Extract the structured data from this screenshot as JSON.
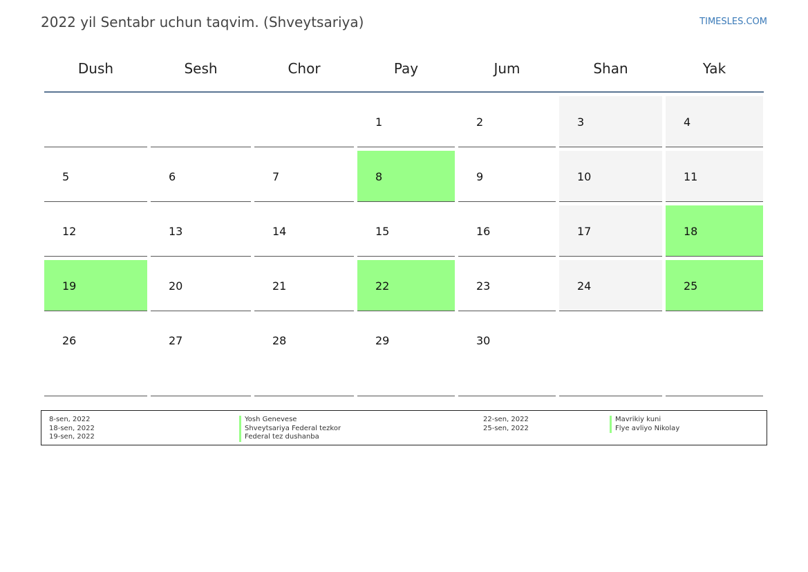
{
  "header": {
    "title": "2022 yil Sentabr uchun taqvim. (Shveytsariya)",
    "site": "TIMESLES.COM"
  },
  "calendar": {
    "weekdays": [
      "Dush",
      "Sesh",
      "Chor",
      "Pay",
      "Jum",
      "Shan",
      "Yak"
    ],
    "weeks": [
      [
        {
          "n": ""
        },
        {
          "n": ""
        },
        {
          "n": ""
        },
        {
          "n": "1"
        },
        {
          "n": "2"
        },
        {
          "n": "3",
          "t": "weekend"
        },
        {
          "n": "4",
          "t": "weekend"
        }
      ],
      [
        {
          "n": "5"
        },
        {
          "n": "6"
        },
        {
          "n": "7"
        },
        {
          "n": "8",
          "t": "holiday"
        },
        {
          "n": "9"
        },
        {
          "n": "10",
          "t": "weekend"
        },
        {
          "n": "11",
          "t": "weekend"
        }
      ],
      [
        {
          "n": "12"
        },
        {
          "n": "13"
        },
        {
          "n": "14"
        },
        {
          "n": "15"
        },
        {
          "n": "16"
        },
        {
          "n": "17",
          "t": "weekend"
        },
        {
          "n": "18",
          "t": "holiday"
        }
      ],
      [
        {
          "n": "19",
          "t": "holiday"
        },
        {
          "n": "20"
        },
        {
          "n": "21"
        },
        {
          "n": "22",
          "t": "holiday"
        },
        {
          "n": "23"
        },
        {
          "n": "24",
          "t": "weekend"
        },
        {
          "n": "25",
          "t": "holiday"
        }
      ],
      [
        {
          "n": "26"
        },
        {
          "n": "27"
        },
        {
          "n": "28"
        },
        {
          "n": "29"
        },
        {
          "n": "30"
        },
        {
          "n": ""
        },
        {
          "n": ""
        }
      ]
    ]
  },
  "legend": {
    "left": {
      "dates": [
        "8-sen, 2022",
        "18-sen, 2022",
        "19-sen, 2022"
      ],
      "names": [
        "Yosh Genevese",
        "Shveytsariya Federal tezkor",
        "Federal tez dushanba"
      ]
    },
    "right": {
      "dates": [
        "22-sen, 2022",
        "25-sen, 2022"
      ],
      "names": [
        "Mavrikiy kuni",
        "Flye avliyo Nikolay"
      ]
    }
  },
  "colors": {
    "holiday": "#99ff88",
    "weekend": "#f4f4f4",
    "header_rule": "#5a7593",
    "site_link": "#3a7ab8"
  }
}
